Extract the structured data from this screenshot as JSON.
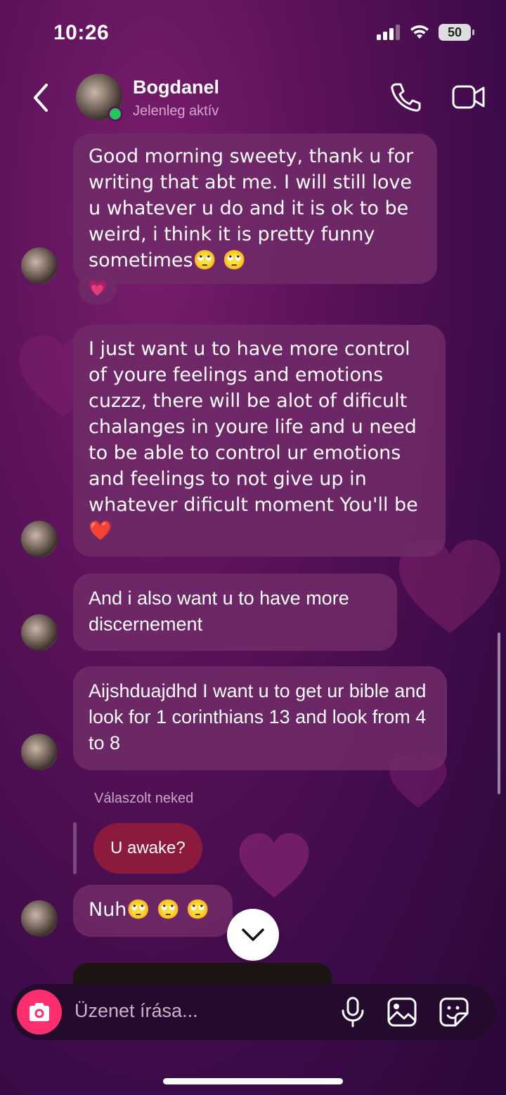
{
  "status_bar": {
    "time": "10:26",
    "battery": "50"
  },
  "header": {
    "name": "Bogdanel",
    "status": "Jelenleg aktív"
  },
  "messages": [
    {
      "text": "Good morning sweety, thank u for writing that abt me. I will still love u whatever u do and it is ok to be weird, i think it is pretty funny sometimes🙄 🙄",
      "reaction": "💗"
    },
    {
      "text": "I just want u to have more control of youre feelings and emotions cuzzz, there will be alot of dificult chalanges in youre life and u need to be able to control ur emotions and feelings to not give up in whatever dificult moment You'll be ❤️"
    },
    {
      "text": "And i also want u to have more discernement"
    },
    {
      "text": "Aijshduajdhd I want u to get ur bible and look for  1 corinthians 13 and look from 4 to 8"
    },
    {
      "text": "Nuh🙄 🙄 🙄"
    }
  ],
  "reply": {
    "label": "Válaszolt neked",
    "quoted_text": "U awake?"
  },
  "composer": {
    "placeholder": "Üzenet írása..."
  },
  "colors": {
    "accent": "#ff2f6d",
    "bubble": "#702a68",
    "reply_bubble": "#8b1a3c",
    "online": "#22c55e"
  }
}
